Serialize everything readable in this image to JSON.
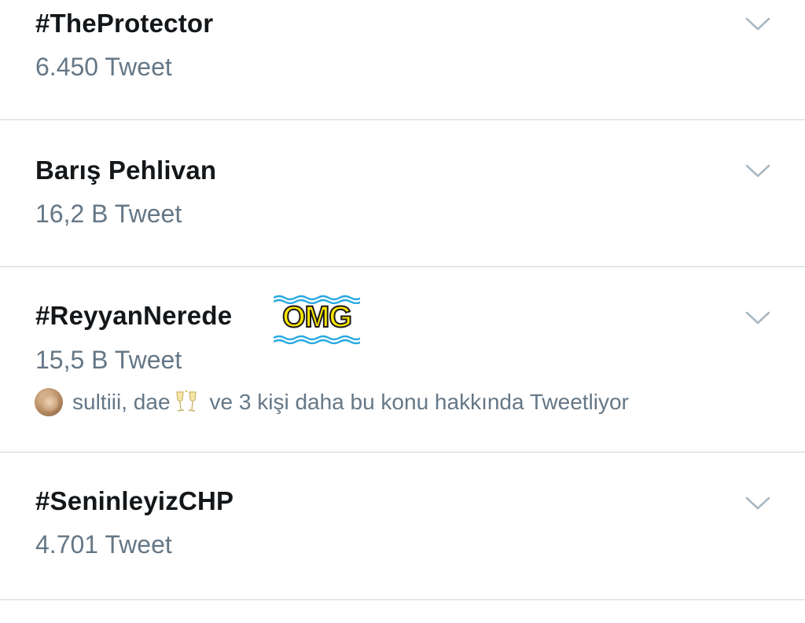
{
  "trends": [
    {
      "name": "#TheProtector",
      "count": "6.450 Tweet"
    },
    {
      "name": "Barış Pehlivan",
      "count": "16,2 B Tweet"
    },
    {
      "name": "#ReyyanNerede",
      "count": "15,5 B Tweet",
      "badge": "OMG",
      "social": {
        "users": "sultiii, dae",
        "emoji_icon": "clinking-glasses-icon",
        "rest": "ve 3 kişi daha bu konu hakkında Tweetliyor"
      }
    },
    {
      "name": "#SeninleyizCHP",
      "count": "4.701 Tweet"
    }
  ],
  "icons": {
    "more": "chevron-down-icon"
  },
  "colors": {
    "title": "#14171a",
    "secondary": "#657786",
    "divider": "#cfd6dd",
    "chevron": "#aab8c2",
    "omg_fill": "#ffe600",
    "omg_wave": "#29a9e0"
  }
}
